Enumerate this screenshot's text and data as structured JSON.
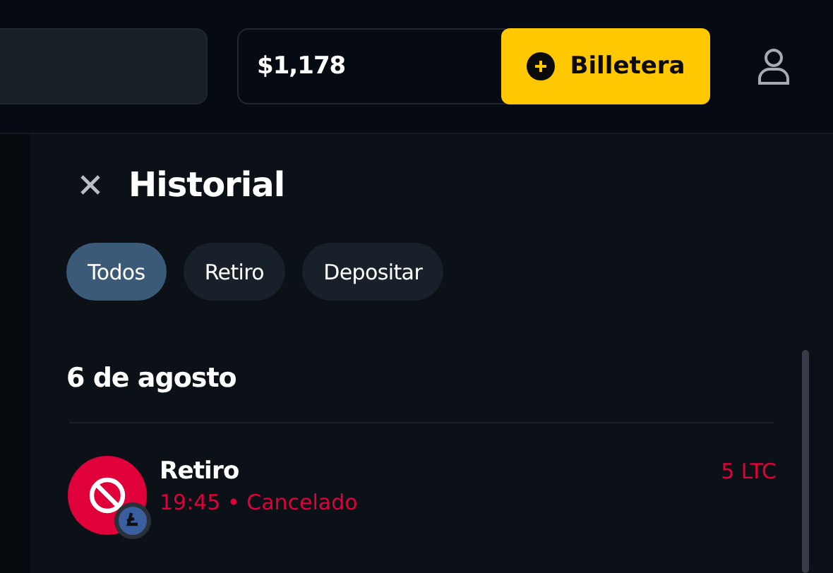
{
  "header": {
    "balance": "$1,178",
    "wallet_button": "Billetera"
  },
  "history": {
    "title": "Historial",
    "tabs": [
      {
        "label": "Todos",
        "selected": true
      },
      {
        "label": "Retiro",
        "selected": false
      },
      {
        "label": "Depositar",
        "selected": false
      }
    ],
    "groups": [
      {
        "date": "6 de agosto",
        "transactions": [
          {
            "title": "Retiro",
            "time": "19:45",
            "separator": "•",
            "status": "Cancelado",
            "color": "#e0003a",
            "amount": "5 LTC"
          }
        ]
      }
    ]
  }
}
